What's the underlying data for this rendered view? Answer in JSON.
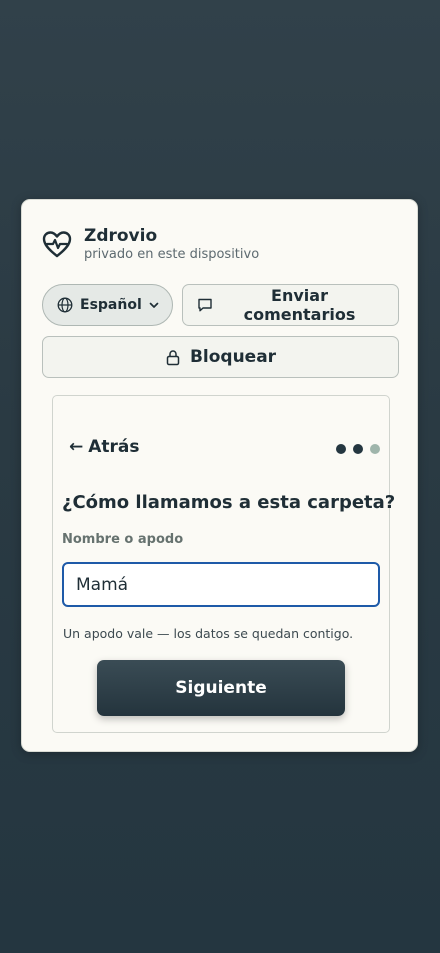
{
  "app": {
    "title": "Zdrovio",
    "subtitle": "privado en este dispositivo"
  },
  "toolbar": {
    "language_label": "Español",
    "feedback_label": "Enviar comentarios",
    "lock_label": "Bloquear"
  },
  "step": {
    "back_label": "Atrás",
    "progress": {
      "total": 3,
      "current": 3,
      "colors": {
        "done": "#243640",
        "current": "#9fb5ab"
      }
    },
    "question": "¿Cómo llamamos a esta carpeta?",
    "field_label": "Nombre o apodo",
    "field_value": "Mamá",
    "hint": "Un apodo vale — los datos se quedan contigo.",
    "next_label": "Siguiente"
  },
  "colors": {
    "accent": "#1e5aa8",
    "primary_button": "#2c3d46"
  },
  "icons": {
    "brand": "heart-pulse-icon",
    "language": "globe-icon",
    "dropdown": "chevron-down-icon",
    "feedback": "speech-bubble-icon",
    "lock": "lock-icon",
    "back": "arrow-left-icon"
  }
}
